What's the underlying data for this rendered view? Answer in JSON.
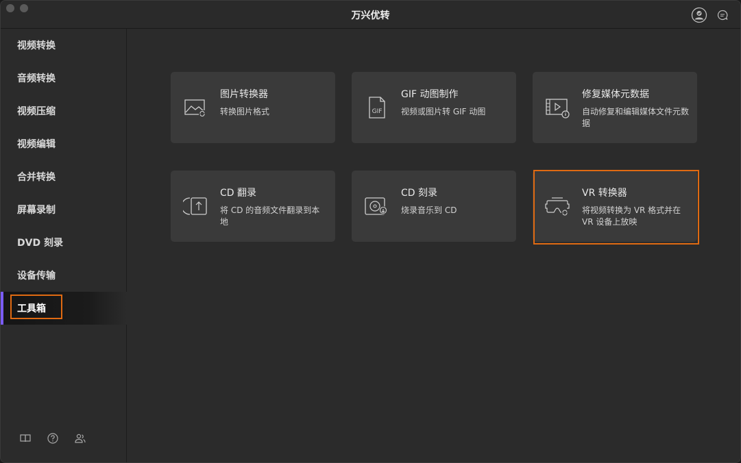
{
  "window": {
    "title": "万兴优转"
  },
  "sidebar": {
    "items": [
      {
        "label": "视频转换"
      },
      {
        "label": "音频转换"
      },
      {
        "label": "视频压缩"
      },
      {
        "label": "视频编辑"
      },
      {
        "label": "合并转换"
      },
      {
        "label": "屏幕录制"
      },
      {
        "label": "DVD 刻录"
      },
      {
        "label": "设备传输"
      },
      {
        "label": "工具箱",
        "active": true
      }
    ],
    "footer_icons": [
      "book-icon",
      "help-icon",
      "users-icon"
    ]
  },
  "tools": [
    {
      "title": "图片转换器",
      "desc": "转换图片格式",
      "icon": "image-convert-icon"
    },
    {
      "title": "GIF 动图制作",
      "desc": "视频或图片转 GIF 动图",
      "icon": "gif-icon"
    },
    {
      "title": "修复媒体元数据",
      "desc": "自动修复和编辑媒体文件元数据",
      "icon": "metadata-icon"
    },
    {
      "title": "CD 翻录",
      "desc": "将 CD 的音频文件翻录到本地",
      "icon": "cd-rip-icon"
    },
    {
      "title": "CD 刻录",
      "desc": "烧录音乐到 CD",
      "icon": "cd-burn-icon"
    },
    {
      "title": "VR 转换器",
      "desc": "将视频转换为 VR 格式并在 VR 设备上放映",
      "icon": "vr-headset-icon"
    }
  ],
  "colors": {
    "accent": "#7b5cf6",
    "highlight": "#e06a12",
    "card": "#3a3a3a"
  }
}
